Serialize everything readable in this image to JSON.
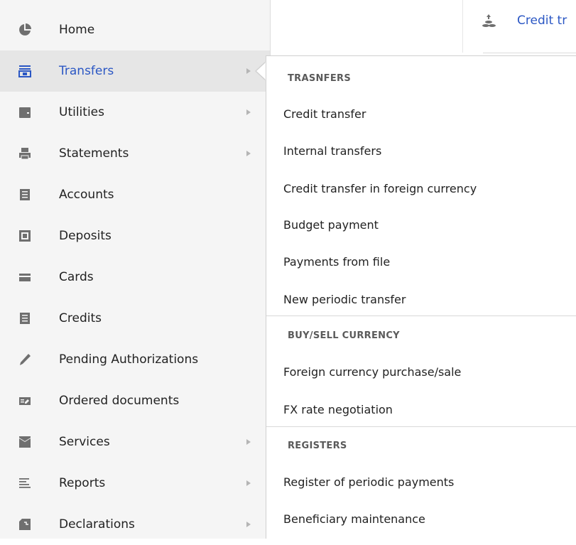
{
  "sidebar": {
    "items": [
      {
        "label": "Home",
        "icon": "pie-chart-icon",
        "has_submenu": false
      },
      {
        "label": "Transfers",
        "icon": "transfer-icon",
        "has_submenu": true,
        "active": true
      },
      {
        "label": "Utilities",
        "icon": "wallet-icon",
        "has_submenu": true
      },
      {
        "label": "Statements",
        "icon": "printer-icon",
        "has_submenu": true
      },
      {
        "label": "Accounts",
        "icon": "list-icon",
        "has_submenu": false
      },
      {
        "label": "Deposits",
        "icon": "safe-icon",
        "has_submenu": false
      },
      {
        "label": "Cards",
        "icon": "card-icon",
        "has_submenu": false
      },
      {
        "label": "Credits",
        "icon": "list-icon",
        "has_submenu": false
      },
      {
        "label": "Pending Authorizations",
        "icon": "pen-icon",
        "has_submenu": false
      },
      {
        "label": "Ordered documents",
        "icon": "document-edit-icon",
        "has_submenu": false
      },
      {
        "label": "Services",
        "icon": "inbox-icon",
        "has_submenu": true
      },
      {
        "label": "Reports",
        "icon": "lines-icon",
        "has_submenu": true
      },
      {
        "label": "Declarations",
        "icon": "declaration-icon",
        "has_submenu": true
      }
    ]
  },
  "top": {
    "link_label": "Credit tr",
    "link_icon": "coins-upload-icon"
  },
  "submenu": {
    "sections": [
      {
        "header": "TRASNFERS",
        "items": [
          "Credit transfer",
          "Internal transfers",
          "Credit transfer in foreign currency",
          "Budget payment",
          "Payments from file",
          "New periodic transfer"
        ]
      },
      {
        "header": "BUY/SELL CURRENCY",
        "items": [
          "Foreign currency purchase/sale",
          "FX rate negotiation"
        ]
      },
      {
        "header": "REGISTERS",
        "items": [
          "Register of periodic payments",
          "Beneficiary maintenance"
        ]
      }
    ]
  },
  "colors": {
    "accent": "#2b57c4",
    "sidebar_bg": "#f5f5f5",
    "active_bg": "#e6e6e6",
    "icon_gray": "#6f6f6f"
  }
}
